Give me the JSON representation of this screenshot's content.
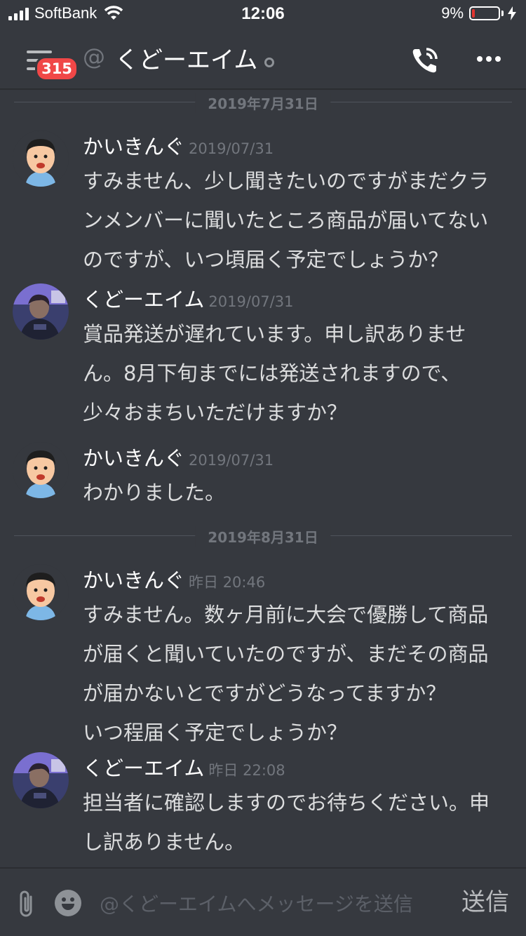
{
  "status_bar": {
    "carrier": "SoftBank",
    "time": "12:06",
    "battery_percent": "9%",
    "battery_level": 0.09
  },
  "header": {
    "unread_badge": "315",
    "at_symbol": "@",
    "channel_name": "くどーエイム"
  },
  "dividers": [
    {
      "label": "2019年7月31日"
    },
    {
      "label": "2019年8月31日"
    }
  ],
  "messages": [
    {
      "author": "かいきんぐ",
      "timestamp": "2019/07/31",
      "lines": [
        "すみません、少し聞きたいのですがまだクラ",
        "ンメンバーに聞いたところ商品が届いてない",
        "のですが、いつ頃届く予定でしょうか？"
      ]
    },
    {
      "author": "くどーエイム",
      "timestamp": "2019/07/31",
      "lines": [
        "賞品発送が遅れています。申し訳ありませ",
        "ん。8月下旬までには発送されますので、",
        "少々おまちいただけますか？"
      ]
    },
    {
      "author": "かいきんぐ",
      "timestamp": "2019/07/31",
      "lines": [
        "わかりました。"
      ]
    },
    {
      "author": "かいきんぐ",
      "timestamp": "昨日 20:46",
      "lines": [
        "すみません。数ヶ月前に大会で優勝して商品",
        "が届くと聞いていたのですが、まだその商品",
        "が届かないとですがどうなってますか？",
        "いつ程届く予定でしょうか？"
      ]
    },
    {
      "author": "くどーエイム",
      "timestamp": "昨日 22:08",
      "lines": [
        "担当者に確認しますのでお待ちください。申",
        "し訳ありません。"
      ]
    }
  ],
  "input": {
    "placeholder": "@くどーエイムへメッセージを送信",
    "send_label": "送信"
  },
  "colors": {
    "background": "#36393f",
    "badge": "#f04747",
    "battery_low": "#e3342f",
    "muted_text": "#72767d"
  },
  "icons": [
    "menu-icon",
    "call-icon",
    "more-icon",
    "paperclip-icon",
    "emoji-icon",
    "wifi-icon",
    "signal-icon",
    "battery-icon",
    "charging-icon"
  ]
}
